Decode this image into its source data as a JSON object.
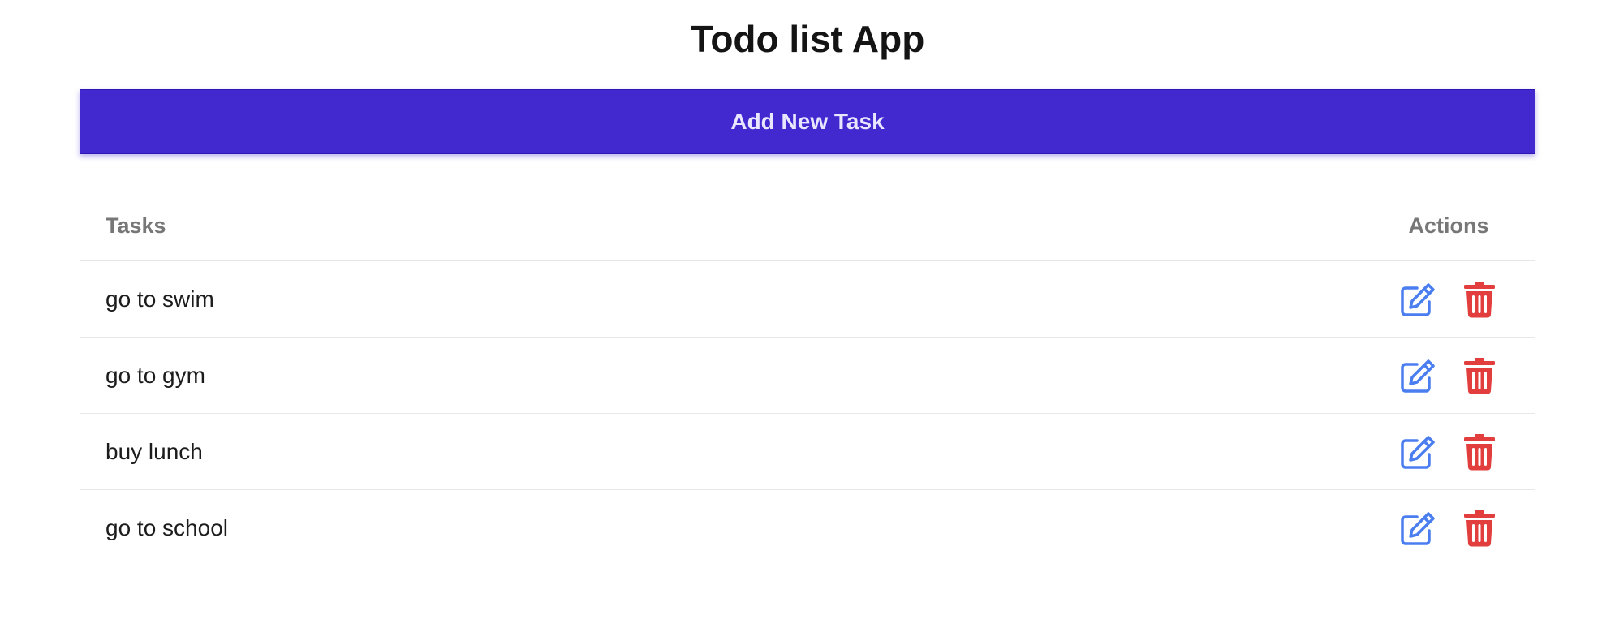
{
  "app": {
    "title": "Todo list App"
  },
  "toolbar": {
    "add_label": "Add New Task"
  },
  "table": {
    "headers": {
      "tasks": "Tasks",
      "actions": "Actions"
    },
    "rows": [
      {
        "task": "go to swim"
      },
      {
        "task": "go to gym"
      },
      {
        "task": "buy lunch"
      },
      {
        "task": "go to school"
      }
    ]
  },
  "icons": {
    "edit": "edit-icon",
    "delete": "trash-icon"
  },
  "colors": {
    "accent": "#4129cf",
    "edit": "#4a7ef0",
    "delete": "#e23e3e",
    "header_text": "#777777"
  }
}
